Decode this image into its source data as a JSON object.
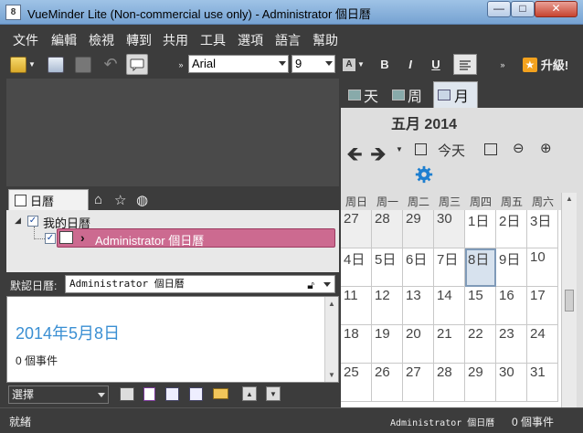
{
  "window": {
    "title": "VueMinder Lite (Non-commercial use only) - Administrator 個日曆",
    "app_icon": "8",
    "minimize": "—",
    "maximize": "□",
    "close": "✕"
  },
  "menu": [
    "文件",
    "編輯",
    "檢視",
    "轉到",
    "共用",
    "工具",
    "選項",
    "語言",
    "幫助"
  ],
  "toolbar": {
    "font": "Arial",
    "size": "9",
    "bold": "B",
    "italic": "I",
    "underline": "U",
    "upgrade": "升級!"
  },
  "left_tabs": {
    "calendar": "日曆"
  },
  "tree": {
    "root": "我的日曆",
    "item": "Administrator 個日曆"
  },
  "default_calendar": {
    "label": "默認日曆:",
    "value": "Administrator 個日曆"
  },
  "detail": {
    "date": "2014年5月8日",
    "events": "0 個事件"
  },
  "bottom_bar": {
    "select_label": "選擇"
  },
  "status": {
    "left": "就緒",
    "calendar": "Administrator 個日曆",
    "events": "0 個事件"
  },
  "view_tabs": {
    "day": "天",
    "week": "周",
    "month": "月"
  },
  "month": {
    "title": "五月 2014",
    "today_button": "今天",
    "weekdays": [
      "周日",
      "周一",
      "周二",
      "周三",
      "周四",
      "周五",
      "周六"
    ],
    "weeks": [
      [
        [
          "27",
          true
        ],
        [
          "28",
          true
        ],
        [
          "29",
          true
        ],
        [
          "30",
          true
        ],
        [
          "1日",
          false
        ],
        [
          "2日",
          false
        ],
        [
          "3日",
          false
        ]
      ],
      [
        [
          "4日",
          false
        ],
        [
          "5日",
          false
        ],
        [
          "6日",
          false
        ],
        [
          "7日",
          false
        ],
        [
          "8日",
          false
        ],
        [
          "9日",
          false
        ],
        [
          "10",
          false
        ]
      ],
      [
        [
          "11",
          false
        ],
        [
          "12",
          false
        ],
        [
          "13",
          false
        ],
        [
          "14",
          false
        ],
        [
          "15",
          false
        ],
        [
          "16",
          false
        ],
        [
          "17",
          false
        ]
      ],
      [
        [
          "18",
          false
        ],
        [
          "19",
          false
        ],
        [
          "20",
          false
        ],
        [
          "21",
          false
        ],
        [
          "22",
          false
        ],
        [
          "23",
          false
        ],
        [
          "24",
          false
        ]
      ],
      [
        [
          "25",
          false
        ],
        [
          "26",
          false
        ],
        [
          "27",
          false
        ],
        [
          "28",
          false
        ],
        [
          "29",
          false
        ],
        [
          "30",
          false
        ],
        [
          "31",
          false
        ]
      ]
    ],
    "today_index": [
      1,
      4
    ]
  }
}
